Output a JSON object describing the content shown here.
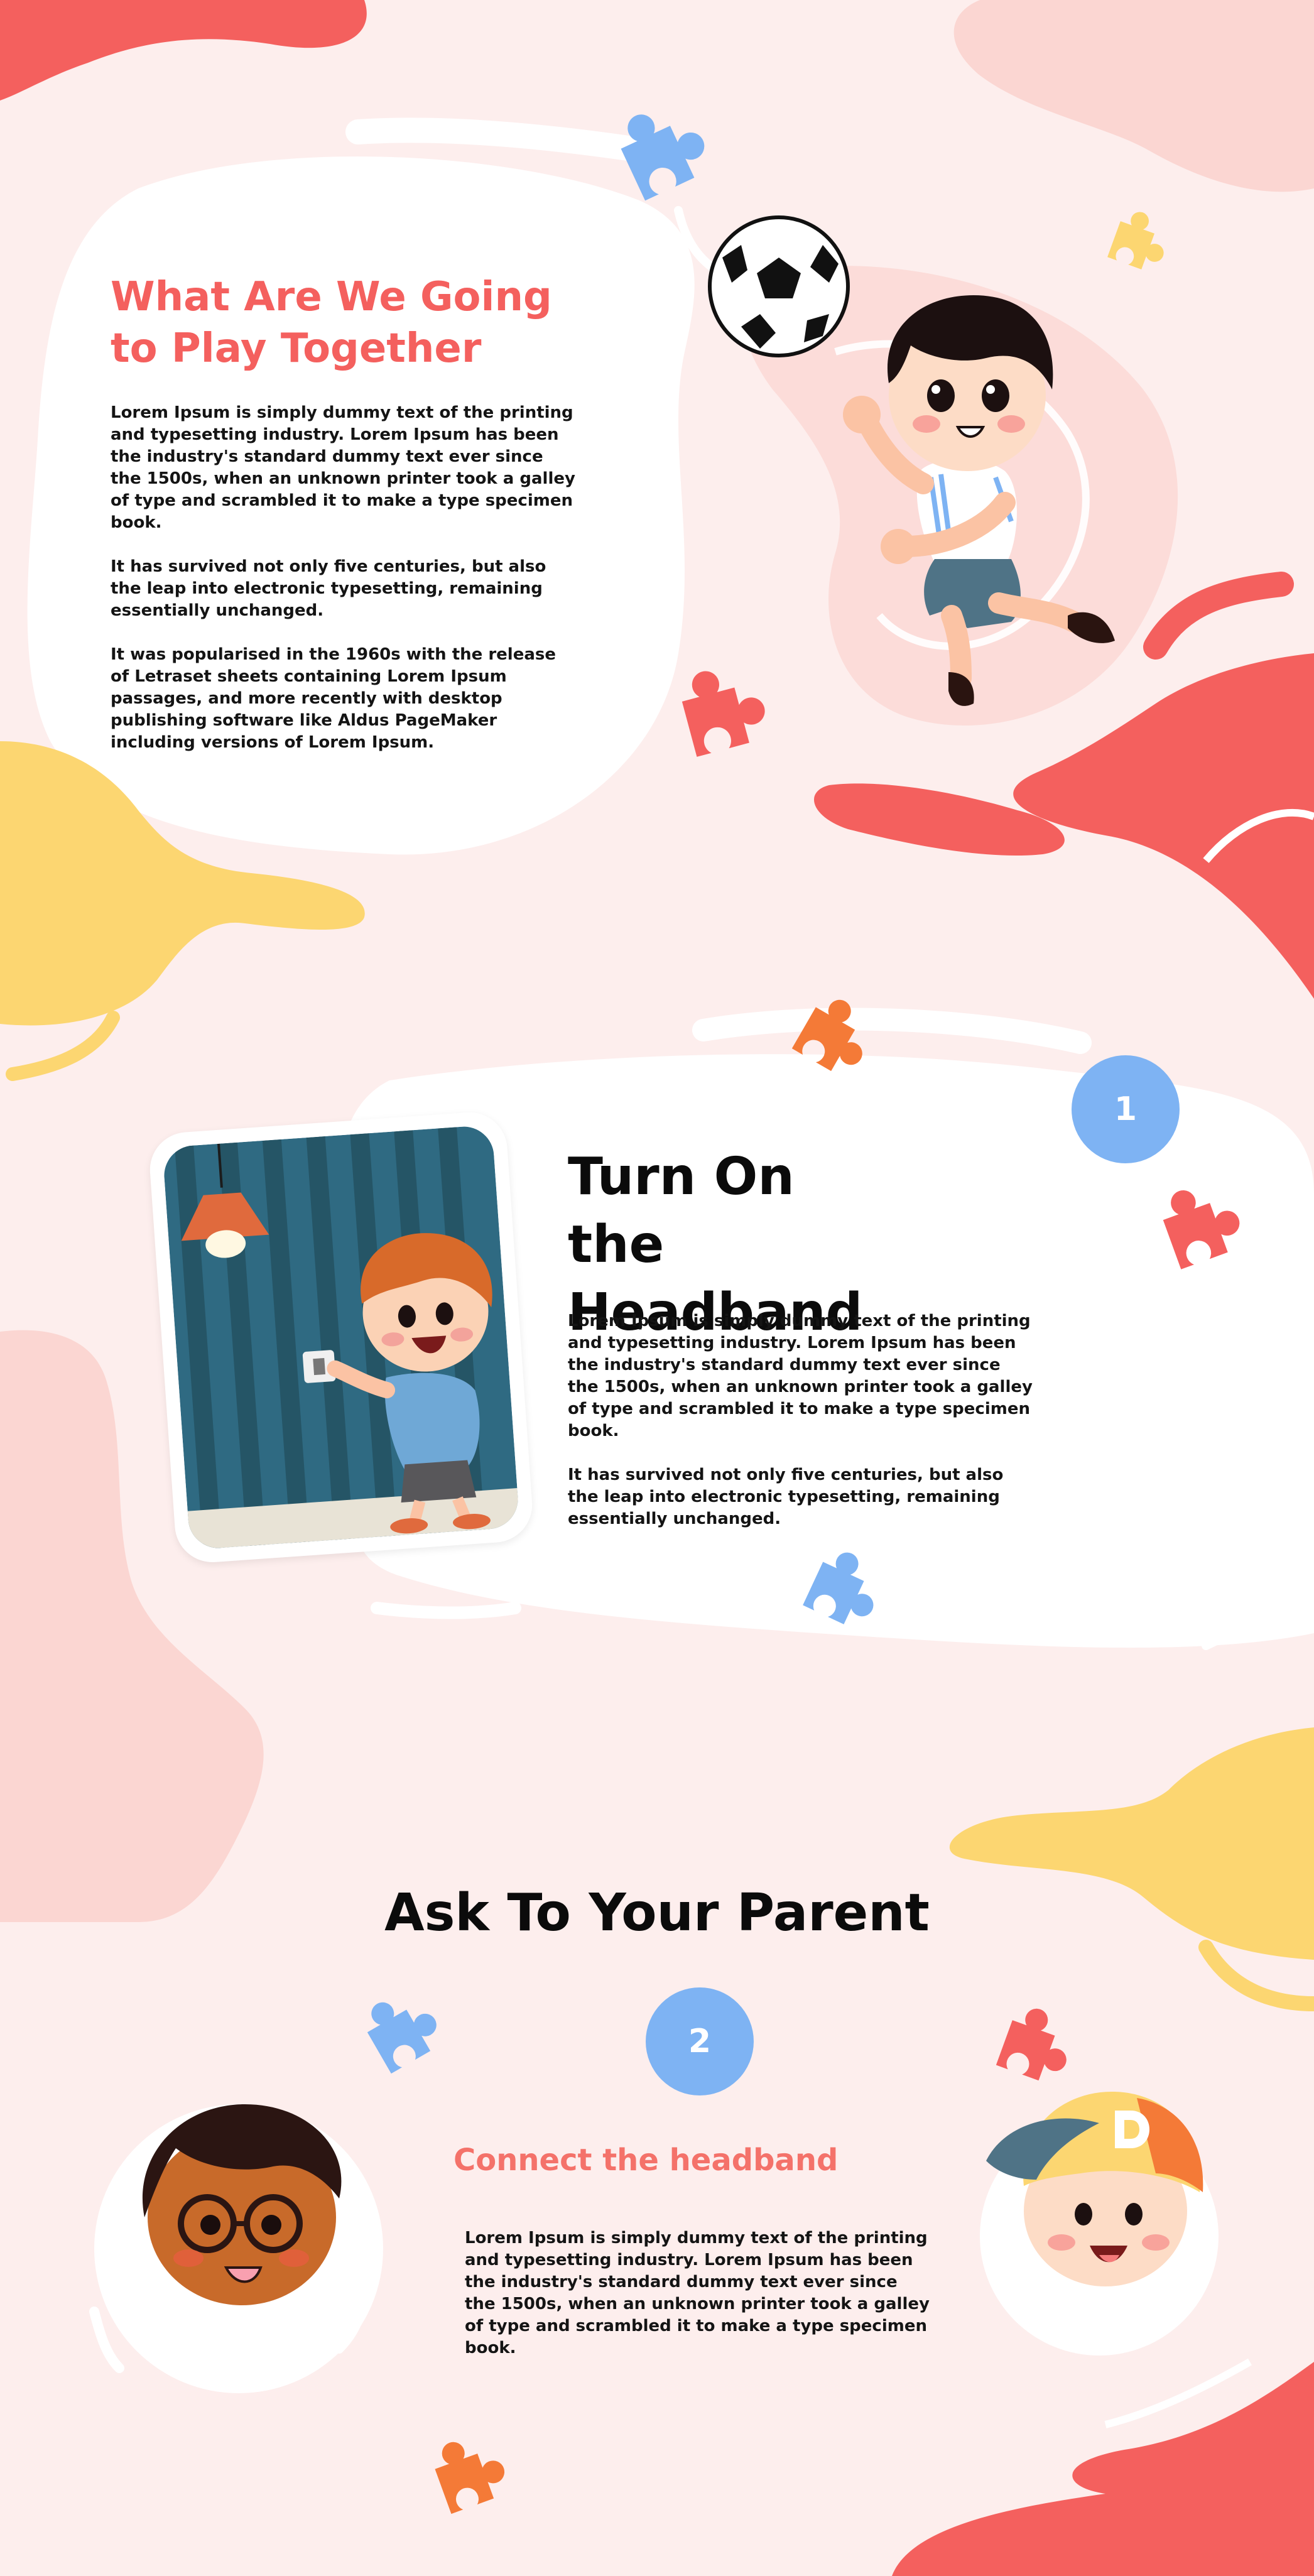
{
  "colors": {
    "background": "#fdeeed",
    "coral": "#f4605e",
    "yellow": "#fcd671",
    "blue": "#7eb3f3",
    "orange": "#f47a37",
    "pink_blob": "#fbd6d2",
    "text": "#141414"
  },
  "section1": {
    "title": "What Are We Going to Play Together",
    "paragraphs": [
      "Lorem Ipsum is simply dummy text of the printing and typesetting industry. Lorem Ipsum has been the industry's standard dummy text ever since the 1500s, when an unknown printer took a galley of type and scrambled it to make a type specimen book.",
      "It has survived not only five centuries, but also the leap into electronic typesetting, remaining essentially unchanged.",
      "It was popularised in the 1960s with the release of Letraset sheets containing Lorem Ipsum passages, and more recently with desktop publishing software like Aldus PageMaker including versions of Lorem Ipsum."
    ],
    "illustration": "boy-kicking-soccer-ball"
  },
  "section2": {
    "step": "1",
    "title": "Turn On the Headband",
    "paragraphs": [
      "Lorem Ipsum is simply dummy text of the printing and typesetting industry. Lorem Ipsum has been the industry's standard dummy text ever since the 1500s, when an unknown printer took a galley of type and scrambled it to make a type specimen book.",
      "It has survived not only five centuries, but also the leap into electronic typesetting, remaining essentially unchanged."
    ],
    "illustration": "boy-turning-on-light-switch"
  },
  "section3": {
    "title": "Ask To Your Parent",
    "step": "2",
    "subtitle": "Connect the headband",
    "paragraphs": [
      "Lorem Ipsum is simply dummy text of the printing and typesetting industry. Lorem Ipsum has been the industry's standard dummy text ever since the 1500s, when an unknown printer took a galley of type and scrambled it to make a type specimen book."
    ],
    "illustrations": [
      "boy-with-glasses-avatar",
      "boy-with-cap-avatar"
    ]
  },
  "decorations": [
    "puzzle-piece-icon",
    "paint-blob"
  ]
}
